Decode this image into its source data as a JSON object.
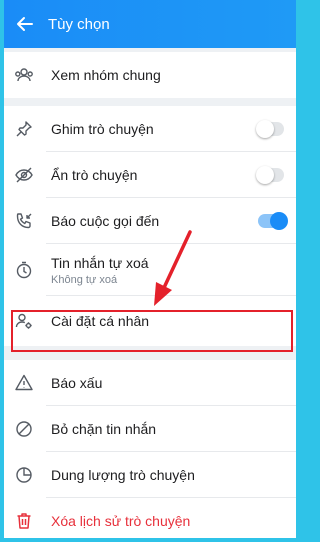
{
  "header": {
    "title": "Tùy chọn"
  },
  "section1": {
    "items": [
      {
        "label": "Xem nhóm chung",
        "icon": "users-group-icon"
      }
    ]
  },
  "section2": {
    "items": [
      {
        "label": "Ghim trò chuyện",
        "icon": "pin-icon",
        "toggle": false
      },
      {
        "label": "Ẩn trò chuyện",
        "icon": "eye-off-icon",
        "toggle": false
      },
      {
        "label": "Báo cuộc gọi đến",
        "icon": "phone-incoming-icon",
        "toggle": true
      },
      {
        "label": "Tin nhắn tự xoá",
        "sublabel": "Không tự xoá",
        "icon": "timer-icon"
      },
      {
        "label": "Cài đặt cá nhân",
        "icon": "user-settings-icon"
      }
    ]
  },
  "section3": {
    "items": [
      {
        "label": "Báo xấu",
        "icon": "warning-icon"
      },
      {
        "label": "Bỏ chặn tin nhắn",
        "icon": "block-icon"
      },
      {
        "label": "Dung lượng trò chuyện",
        "icon": "pie-chart-icon"
      },
      {
        "label": "Xóa lịch sử trò chuyện",
        "icon": "trash-icon"
      }
    ]
  },
  "colors": {
    "header": "#1a8cf7",
    "annotation": "#e4212b",
    "danger": "#e7303b"
  }
}
